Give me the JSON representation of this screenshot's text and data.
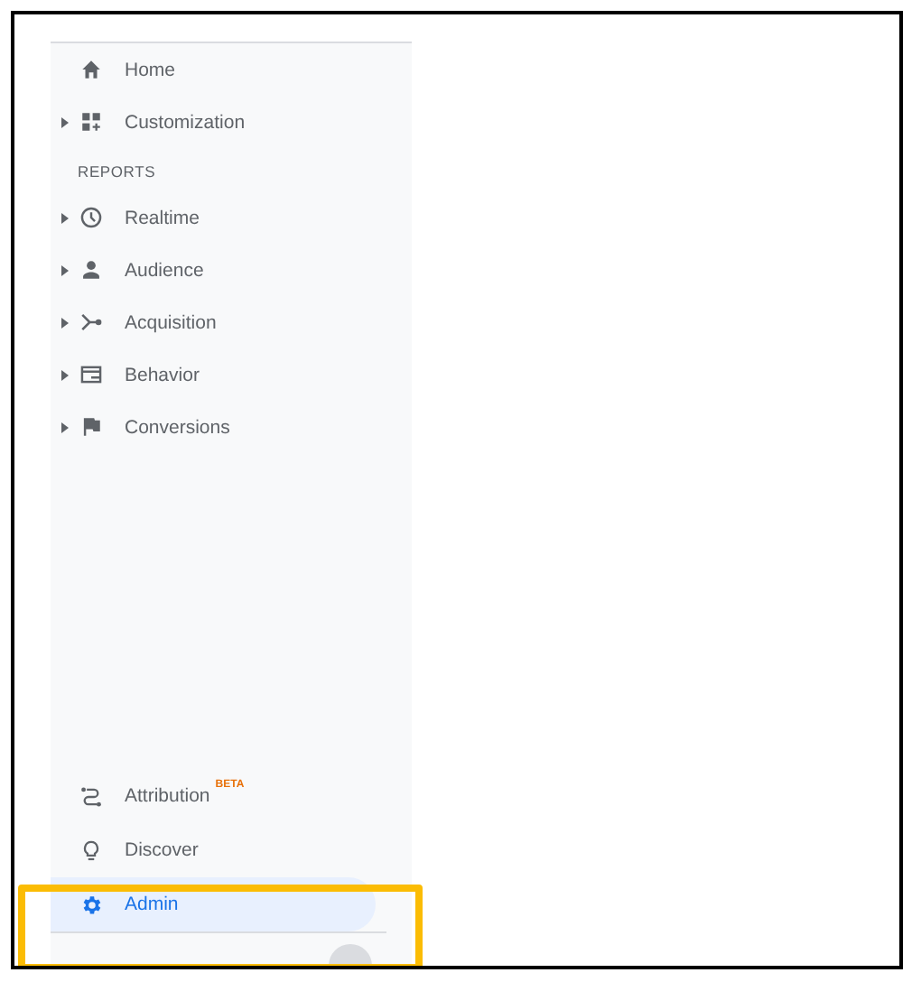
{
  "sidebar": {
    "top_items": [
      {
        "label": "Home",
        "expandable": false,
        "selected": false
      },
      {
        "label": "Customization",
        "expandable": true,
        "selected": false
      }
    ],
    "section_heading": "REPORTS",
    "report_items": [
      {
        "label": "Realtime",
        "expandable": true,
        "selected": false
      },
      {
        "label": "Audience",
        "expandable": true,
        "selected": false
      },
      {
        "label": "Acquisition",
        "expandable": true,
        "selected": false
      },
      {
        "label": "Behavior",
        "expandable": true,
        "selected": false
      },
      {
        "label": "Conversions",
        "expandable": true,
        "selected": false
      }
    ],
    "bottom_items": [
      {
        "label": "Attribution",
        "badge": "BETA",
        "selected": false
      },
      {
        "label": "Discover",
        "selected": false
      },
      {
        "label": "Admin",
        "selected": true
      }
    ]
  }
}
